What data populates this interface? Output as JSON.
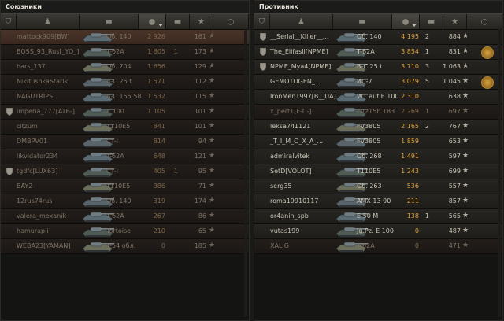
{
  "allies": {
    "title": "Союзники",
    "rows": [
      {
        "name": "mattock909[BW]",
        "vehicle": "Об. 140",
        "damage": "2 926",
        "frags": "",
        "xp": "161",
        "clan": false,
        "dead": true,
        "me": true
      },
      {
        "name": "BOSS_93_Rus[_YO_]",
        "vehicle": "T-62A",
        "damage": "1 805",
        "frags": "1",
        "xp": "173",
        "clan": false,
        "dead": true
      },
      {
        "name": "bars_137",
        "vehicle": "Об. 704",
        "damage": "1 656",
        "frags": "",
        "xp": "129",
        "clan": false,
        "dead": true
      },
      {
        "name": "NikitushkaStarik",
        "vehicle": "B-C 25 t",
        "damage": "1 571",
        "frags": "",
        "xp": "112",
        "clan": false,
        "dead": true
      },
      {
        "name": "NAGUTRIPS",
        "vehicle": "B-C 155 58",
        "damage": "1 532",
        "frags": "",
        "xp": "115",
        "clan": false,
        "dead": true
      },
      {
        "name": "imperia_777[ATB-]",
        "vehicle": "E 100",
        "damage": "1 105",
        "frags": "",
        "xp": "101",
        "clan": true,
        "dead": true
      },
      {
        "name": "citzum",
        "vehicle": "T110E5",
        "damage": "841",
        "frags": "",
        "xp": "101",
        "clan": false,
        "dead": true
      },
      {
        "name": "DMBPV01",
        "vehicle": "CT-I",
        "damage": "814",
        "frags": "",
        "xp": "94",
        "clan": false,
        "dead": true
      },
      {
        "name": "likvidator234",
        "vehicle": "T-62A",
        "damage": "648",
        "frags": "",
        "xp": "121",
        "clan": false,
        "dead": true
      },
      {
        "name": "tgdfc[LUX63]",
        "vehicle": "CT-I",
        "damage": "405",
        "frags": "1",
        "xp": "95",
        "clan": true,
        "dead": true
      },
      {
        "name": "BAY2",
        "vehicle": "T110E5",
        "damage": "386",
        "frags": "",
        "xp": "71",
        "clan": false,
        "dead": true
      },
      {
        "name": "12rus74rus",
        "vehicle": "Об. 140",
        "damage": "319",
        "frags": "",
        "xp": "174",
        "clan": false,
        "dead": true
      },
      {
        "name": "valera_mexanik",
        "vehicle": "T-62A",
        "damage": "267",
        "frags": "",
        "xp": "86",
        "clan": false,
        "dead": true
      },
      {
        "name": "hamurapii",
        "vehicle": "Tortoise",
        "damage": "210",
        "frags": "",
        "xp": "65",
        "clan": false,
        "dead": true
      },
      {
        "name": "WEBA23[YAMAN]",
        "vehicle": "T-54 обл.",
        "damage": "0",
        "frags": "",
        "xp": "185",
        "clan": false,
        "dead": true
      }
    ]
  },
  "enemies": {
    "title": "Противник",
    "rows": [
      {
        "name": "__Serial__Killer__...",
        "vehicle": "Об. 140",
        "damage": "4 195",
        "frags": "2",
        "xp": "884",
        "clan": true,
        "dead": false
      },
      {
        "name": "The_Elifasll[NPME]",
        "vehicle": "T-62A",
        "damage": "3 854",
        "frags": "1",
        "xp": "831",
        "clan": true,
        "dead": false,
        "medal": true
      },
      {
        "name": "NPME_Mya4[NPME]",
        "vehicle": "B-C 25 t",
        "damage": "3 710",
        "frags": "3",
        "xp": "1 063",
        "clan": true,
        "dead": false
      },
      {
        "name": "GEMOTOGEN_...",
        "vehicle": "ИС-7",
        "damage": "3 079",
        "frags": "5",
        "xp": "1 045",
        "clan": false,
        "dead": false,
        "medal": true
      },
      {
        "name": "IronMen1997[B__UA]",
        "vehicle": "WT auf E 100",
        "damage": "2 310",
        "frags": "",
        "xp": "638",
        "clan": false,
        "dead": false
      },
      {
        "name": "x_pert1[F-C-]",
        "vehicle": "FV215b 183",
        "damage": "2 269",
        "frags": "1",
        "xp": "697",
        "clan": false,
        "dead": true
      },
      {
        "name": "leksa741121",
        "vehicle": "FV3805",
        "damage": "2 165",
        "frags": "2",
        "xp": "767",
        "clan": false,
        "dead": false
      },
      {
        "name": "_T_I_M_O_X_A_...",
        "vehicle": "FV3805",
        "damage": "1 859",
        "frags": "",
        "xp": "653",
        "clan": false,
        "dead": false
      },
      {
        "name": "admiralvitek",
        "vehicle": "Об. 268",
        "damage": "1 491",
        "frags": "",
        "xp": "597",
        "clan": false,
        "dead": false
      },
      {
        "name": "SetD[VOLOT]",
        "vehicle": "T110E5",
        "damage": "1 243",
        "frags": "",
        "xp": "699",
        "clan": false,
        "dead": false
      },
      {
        "name": "serg35",
        "vehicle": "Об. 263",
        "damage": "536",
        "frags": "",
        "xp": "557",
        "clan": false,
        "dead": false
      },
      {
        "name": "roma19910117",
        "vehicle": "AMX 13 90",
        "damage": "211",
        "frags": "",
        "xp": "857",
        "clan": false,
        "dead": false
      },
      {
        "name": "or4anin_spb",
        "vehicle": "E 50 M",
        "damage": "138",
        "frags": "1",
        "xp": "565",
        "clan": false,
        "dead": false
      },
      {
        "name": "vutas199",
        "vehicle": "Jg.Pz. E 100",
        "damage": "0",
        "frags": "",
        "xp": "487",
        "clan": false,
        "dead": false
      },
      {
        "name": "XALIG",
        "vehicle": "T-62A",
        "damage": "0",
        "frags": "",
        "xp": "471",
        "clan": false,
        "dead": true
      }
    ]
  },
  "colors": {
    "damage": "#e0a23a",
    "dead_text": "#7e7264",
    "me_row": "#4a3428"
  }
}
